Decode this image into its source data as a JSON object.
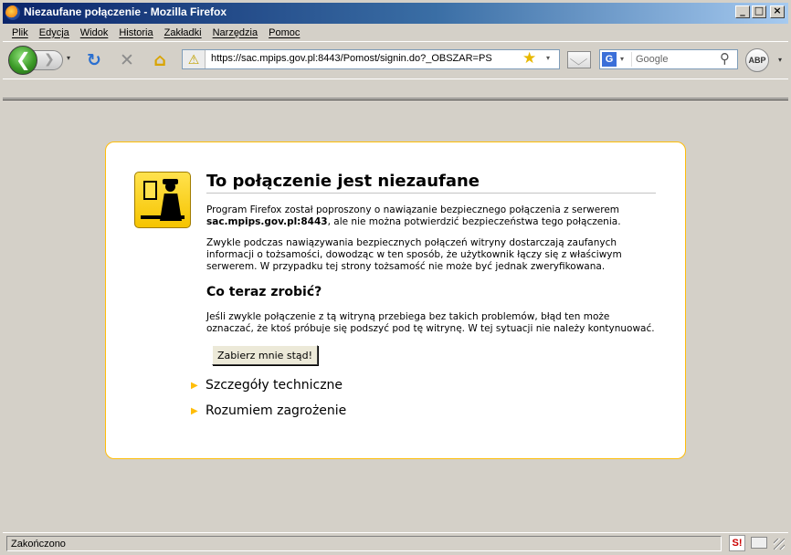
{
  "window": {
    "title": "Niezaufane połączenie - Mozilla Firefox",
    "minimize": "_",
    "maximize": "□",
    "close": "×"
  },
  "menu": [
    "Plik",
    "Edycja",
    "Widok",
    "Historia",
    "Zakładki",
    "Narzędzia",
    "Pomoc"
  ],
  "toolbar": {
    "back_glyph": "❮",
    "forward_glyph": "❯",
    "dropdown_glyph": "▾",
    "reload_glyph": "↻",
    "stop_glyph": "✕",
    "home_glyph": "⌂",
    "url": "https://sac.mpips.gov.pl:8443/Pomost/signin.do?_OBSZAR=PS",
    "warning_glyph": "⚠",
    "star_glyph": "★",
    "search_engine_label": "G",
    "search_placeholder": "Google",
    "search_glyph": "⚲",
    "abp_label": "ABP"
  },
  "page": {
    "title": "To połączenie jest niezaufane",
    "p1_before": "Program Firefox został poproszony o nawiązanie bezpiecznego połączenia z serwerem ",
    "p1_host": "sac.mpips.gov.pl:8443",
    "p1_after": ", ale nie można potwierdzić bezpieczeństwa tego połączenia.",
    "p2": "Zwykle podczas nawiązywania bezpiecznych połączeń witryny dostarczają zaufanych informacji o tożsamości, dowodząc w ten sposób, że użytkownik łączy się z właściwym serwerem. W przypadku tej strony tożsamość nie może być jednak zweryfikowana.",
    "h2": "Co teraz zrobić?",
    "p3": "Jeśli zwykle połączenie z tą witryną przebiega bez takich problemów, błąd ten może oznaczać, że ktoś próbuje się podszyć pod tę witrynę. W tej sytuacji nie należy kontynuować.",
    "button": "Zabierz mnie stąd!",
    "expander_glyph": "▶",
    "tech_details": "Szczegóły techniczne",
    "understand_risks": "Rozumiem zagrożenie"
  },
  "status": {
    "text": "Zakończono",
    "icon_label": "S!"
  },
  "colors": {
    "card_border": "#ffbd09",
    "titlebar_start": "#0a246a",
    "titlebar_end": "#a6caf0",
    "chrome": "#d4d0c8"
  }
}
